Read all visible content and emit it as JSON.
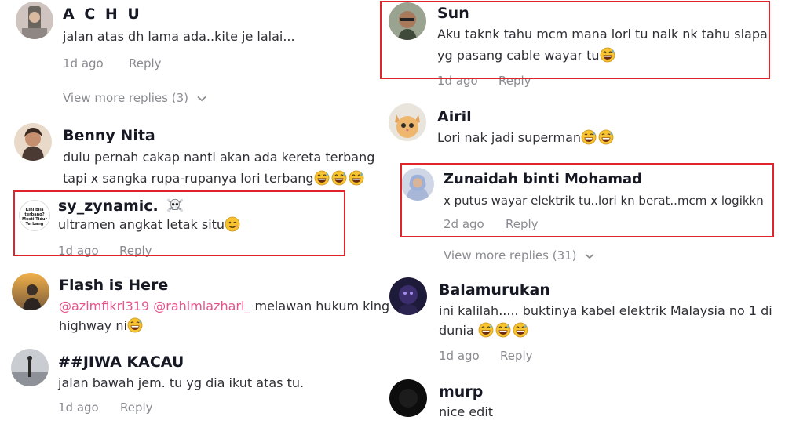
{
  "left": {
    "c1": {
      "user": "A C H U",
      "text": "jalan atas dh lama ada..kite je lalai...",
      "time": "1d ago",
      "reply": "Reply",
      "view_more": "View more replies (3)"
    },
    "c2": {
      "user": "Benny Nita",
      "text1": "dulu pernah cakap nanti akan ada kereta terbang",
      "text2": "tapi x sangka rupa-rupanya lori terbang"
    },
    "c3": {
      "user": "sy_zynamic.",
      "text": "ultramen angkat letak situ",
      "time": "1d ago",
      "reply": "Reply",
      "avatar_text": "Kini bila terbang? Mesti Tidur Terbang"
    },
    "c4": {
      "user": "Flash is Here",
      "mention1": "@azimfikri319",
      "mention2": "@rahimiazhari_",
      "text1": " melawan hukum king of",
      "text2": "highway ni"
    },
    "c5": {
      "user": "##JIWA KACAU",
      "text": "jalan bawah jem. tu yg dia ikut atas tu.",
      "time": "1d ago",
      "reply": "Reply"
    }
  },
  "right": {
    "c1": {
      "user": "Sun",
      "text1": "Aku taknk tahu mcm mana lori tu naik nk tahu siapa",
      "text2": "yg pasang cable wayar tu",
      "time": "1d ago",
      "reply": "Reply"
    },
    "c2": {
      "user": "Airil",
      "text": "Lori nak jadi superman"
    },
    "c3": {
      "user": "Zunaidah binti Mohamad",
      "text": "x putus wayar elektrik tu..lori kn berat..mcm x logikkn",
      "time": "2d ago",
      "reply": "Reply",
      "view_more": "View more replies (31)"
    },
    "c4": {
      "user": "Balamurukan",
      "text1": "ini kalilah..... buktinya kabel elektrik Malaysia no 1 di",
      "text2": "dunia",
      "time": "1d ago",
      "reply": "Reply"
    },
    "c5": {
      "user": "murp",
      "text": "nice edit"
    }
  },
  "colors": {
    "highlight_box": "#e0242b",
    "mention": "#e5548a",
    "meta": "#8a8b91"
  },
  "icons": [
    "grinning-sweat-emoji",
    "winking-emoji",
    "skull-crossbones-emoji",
    "chevron-down-icon"
  ]
}
